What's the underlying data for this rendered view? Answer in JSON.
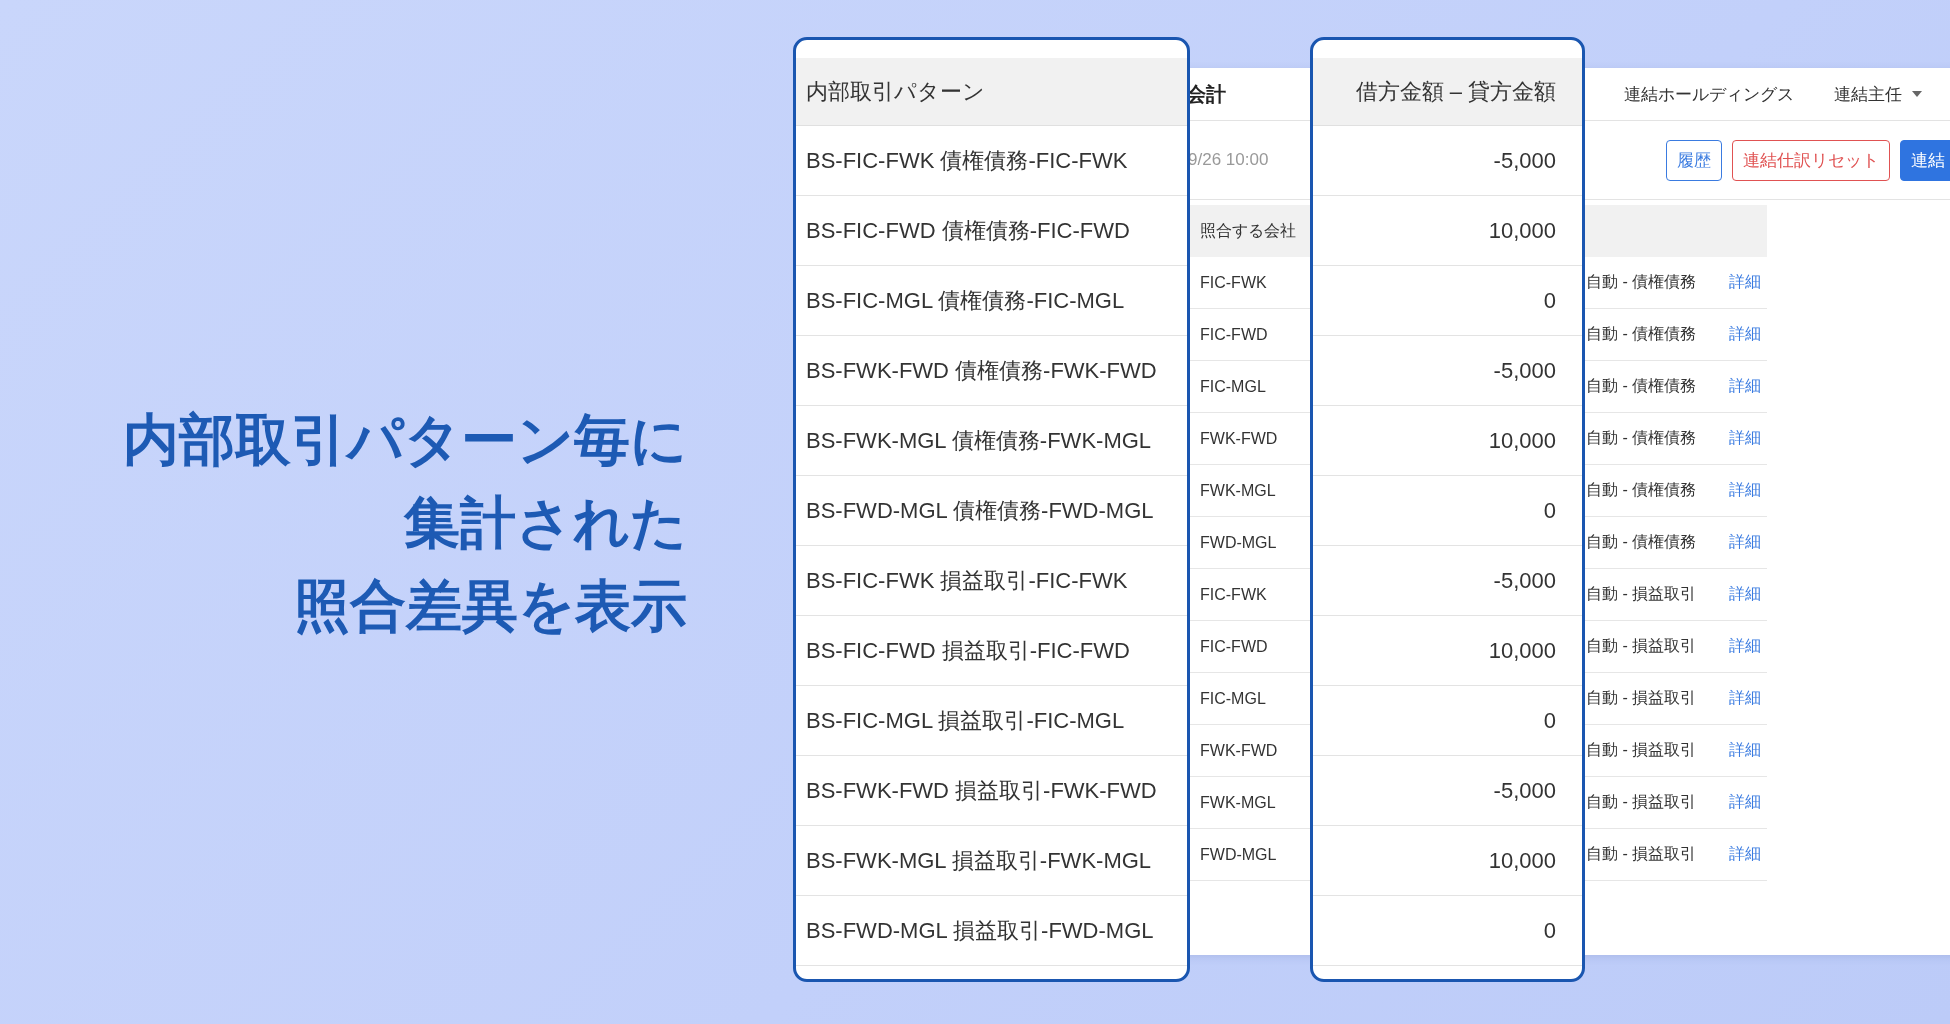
{
  "headline": [
    "内部取引パターン毎に",
    "集計された",
    "照合差異を表示"
  ],
  "app_window": {
    "title_fragment": "会計",
    "company": "連結ホールディングス",
    "user": "連結主任",
    "timestamp": "9/26 10:00",
    "buttons": [
      {
        "label": "履歴",
        "kind": "outline"
      },
      {
        "label": "連結仕訳リセット",
        "kind": "danger"
      },
      {
        "label": "連結",
        "kind": "primary"
      }
    ],
    "table": {
      "header": "照合する会社",
      "rows": [
        {
          "company": "FIC-FWK",
          "type": "自動 - 債権債務",
          "link": "詳細"
        },
        {
          "company": "FIC-FWD",
          "type": "自動 - 債権債務",
          "link": "詳細"
        },
        {
          "company": "FIC-MGL",
          "type": "自動 - 債権債務",
          "link": "詳細"
        },
        {
          "company": "FWK-FWD",
          "type": "自動 - 債権債務",
          "link": "詳細"
        },
        {
          "company": "FWK-MGL",
          "type": "自動 - 債権債務",
          "link": "詳細"
        },
        {
          "company": "FWD-MGL",
          "type": "自動 - 債権債務",
          "link": "詳細"
        },
        {
          "company": "FIC-FWK",
          "type": "自動 - 損益取引",
          "link": "詳細"
        },
        {
          "company": "FIC-FWD",
          "type": "自動 - 損益取引",
          "link": "詳細"
        },
        {
          "company": "FIC-MGL",
          "type": "自動 - 損益取引",
          "link": "詳細"
        },
        {
          "company": "FWK-FWD",
          "type": "自動 - 損益取引",
          "link": "詳細"
        },
        {
          "company": "FWK-MGL",
          "type": "自動 - 損益取引",
          "link": "詳細"
        },
        {
          "company": "FWD-MGL",
          "type": "自動 - 損益取引",
          "link": "詳細"
        }
      ]
    }
  },
  "pattern_card": {
    "header": "内部取引パターン",
    "rows": [
      "BS-FIC-FWK 債権債務-FIC-FWK",
      "BS-FIC-FWD 債権債務-FIC-FWD",
      "BS-FIC-MGL 債権債務-FIC-MGL",
      "BS-FWK-FWD 債権債務-FWK-FWD",
      "BS-FWK-MGL 債権債務-FWK-MGL",
      "BS-FWD-MGL 債権債務-FWD-MGL",
      "BS-FIC-FWK 損益取引-FIC-FWK",
      "BS-FIC-FWD 損益取引-FIC-FWD",
      "BS-FIC-MGL 損益取引-FIC-MGL",
      "BS-FWK-FWD 損益取引-FWK-FWD",
      "BS-FWK-MGL 損益取引-FWK-MGL",
      "BS-FWD-MGL 損益取引-FWD-MGL"
    ]
  },
  "difference_card": {
    "header": "借方金額 – 貸方金額",
    "rows": [
      "-5,000",
      "10,000",
      "0",
      "-5,000",
      "10,000",
      "0",
      "-5,000",
      "10,000",
      "0",
      "-5,000",
      "10,000",
      "0"
    ]
  }
}
